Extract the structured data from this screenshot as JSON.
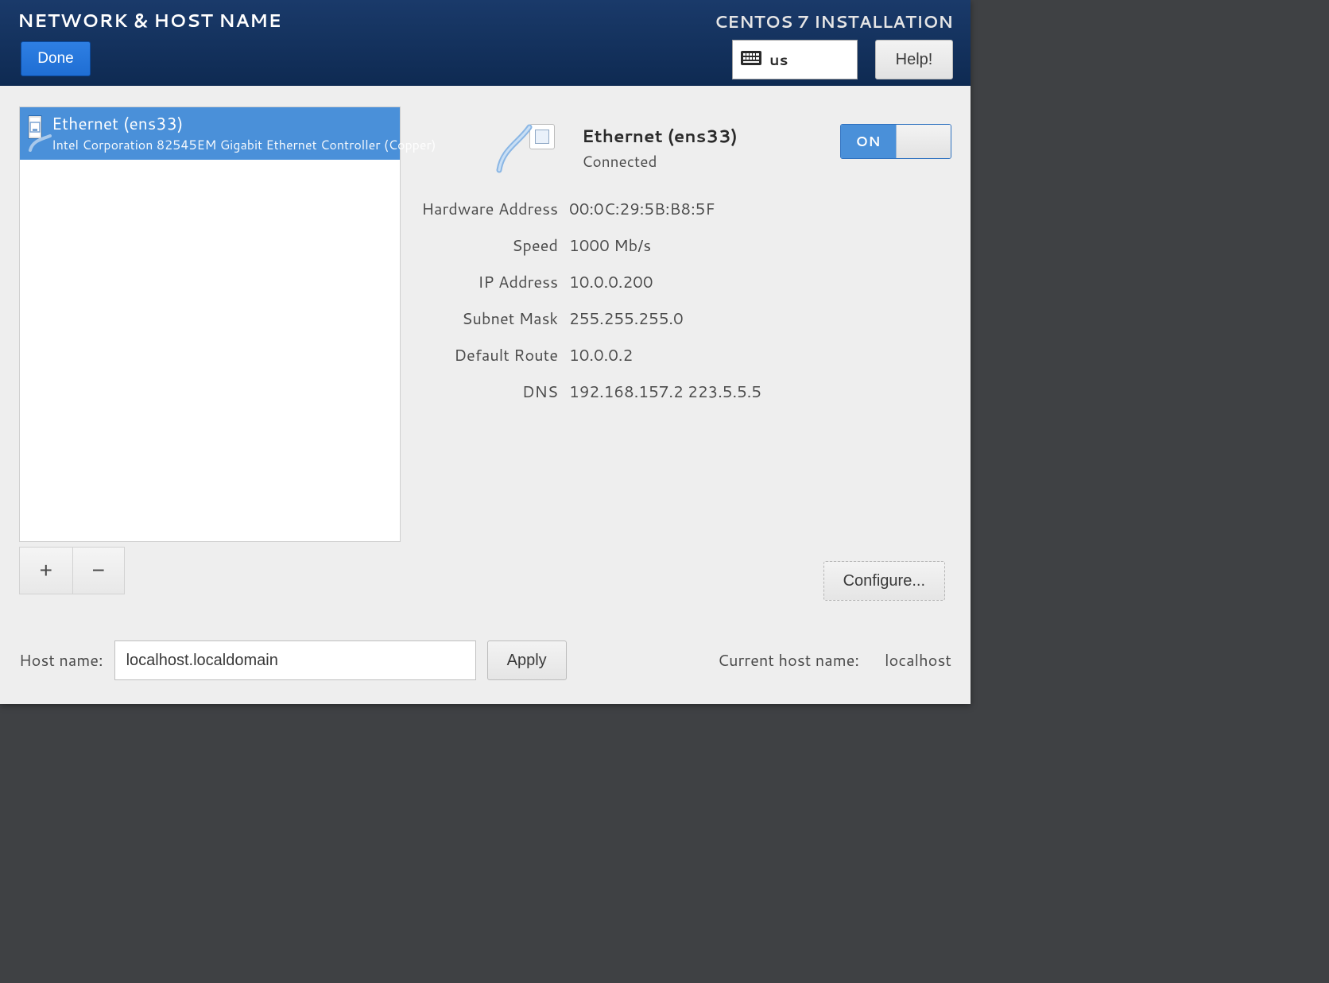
{
  "header": {
    "title": "NETWORK & HOST NAME",
    "done_label": "Done",
    "install_label": "CENTOS 7 INSTALLATION",
    "keyboard_layout": "us",
    "help_label": "Help!"
  },
  "interfaces": {
    "selected_index": 0,
    "items": [
      {
        "name": "Ethernet (ens33)",
        "description": "Intel Corporation 82545EM Gigabit Ethernet Controller (Copper)"
      }
    ]
  },
  "interface_detail": {
    "title": "Ethernet (ens33)",
    "status": "Connected",
    "enabled": true,
    "toggle_on_label": "ON",
    "rows": {
      "hardware_address": {
        "label": "Hardware Address",
        "value": "00:0C:29:5B:B8:5F"
      },
      "speed": {
        "label": "Speed",
        "value": "1000 Mb/s"
      },
      "ip_address": {
        "label": "IP Address",
        "value": "10.0.0.200"
      },
      "subnet_mask": {
        "label": "Subnet Mask",
        "value": "255.255.255.0"
      },
      "default_route": {
        "label": "Default Route",
        "value": "10.0.0.2"
      },
      "dns": {
        "label": "DNS",
        "value": "192.168.157.2 223.5.5.5"
      }
    }
  },
  "buttons": {
    "add": "+",
    "remove": "−",
    "configure": "Configure...",
    "apply": "Apply"
  },
  "hostname": {
    "label": "Host name:",
    "value": "localhost.localdomain",
    "current_label": "Current host name:",
    "current_value": "localhost"
  }
}
